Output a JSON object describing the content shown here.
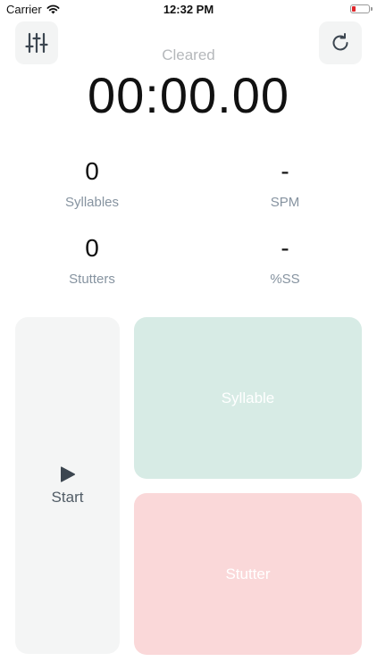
{
  "status_bar": {
    "carrier": "Carrier",
    "time": "12:32 PM",
    "battery_color": "#e0262a"
  },
  "toolbar": {
    "settings_icon": "sliders-icon",
    "reset_icon": "refresh-icon"
  },
  "timer": {
    "status": "Cleared",
    "display": "00:00.00"
  },
  "stats": {
    "syllables": {
      "value": "0",
      "label": "Syllables"
    },
    "spm": {
      "value": "-",
      "label": "SPM"
    },
    "stutters": {
      "value": "0",
      "label": "Stutters"
    },
    "percent_ss": {
      "value": "-",
      "label": "%SS"
    }
  },
  "controls": {
    "start_label": "Start",
    "start_icon": "play-icon",
    "syllable_label": "Syllable",
    "stutter_label": "Stutter",
    "syllable_color": "#d7ebe5",
    "stutter_color": "#fad8d9"
  }
}
